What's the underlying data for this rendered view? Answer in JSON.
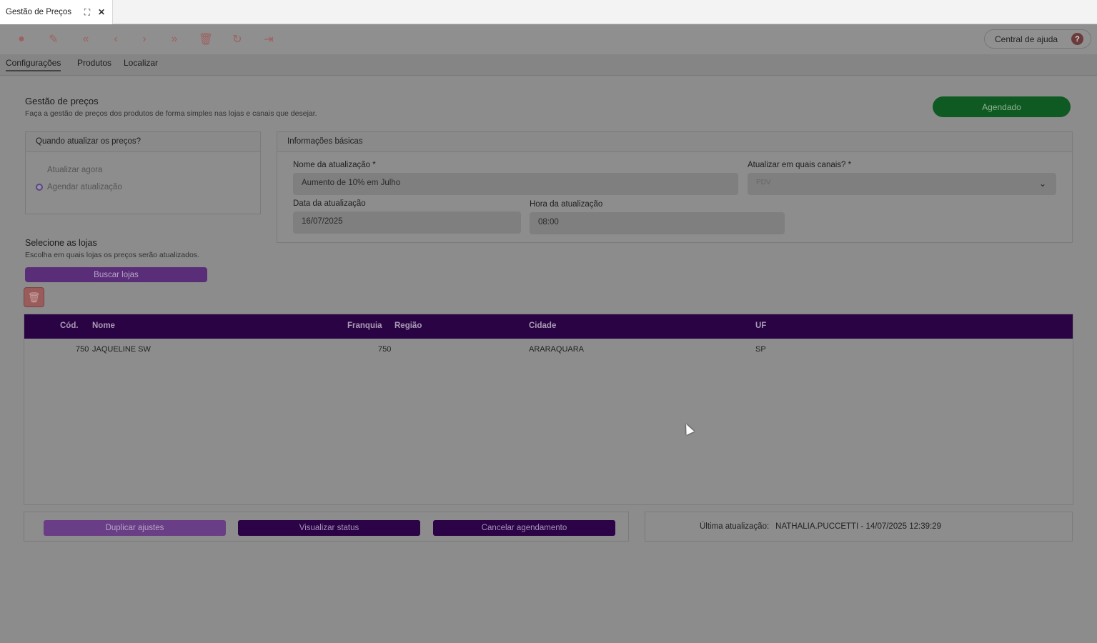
{
  "window": {
    "tab_title": "Gestão de Preços",
    "maximize_glyph": "⛶",
    "close_glyph": "✕"
  },
  "toolbar": {
    "buttons": [
      {
        "name": "add-icon",
        "glyph": "●"
      },
      {
        "name": "edit-icon",
        "glyph": "✎"
      },
      {
        "name": "first-icon",
        "glyph": "«"
      },
      {
        "name": "prev-icon",
        "glyph": "‹"
      },
      {
        "name": "next-icon",
        "glyph": "›"
      },
      {
        "name": "last-icon",
        "glyph": "»"
      },
      {
        "name": "delete-icon",
        "glyph": "🗑"
      },
      {
        "name": "refresh-icon",
        "glyph": "↻"
      },
      {
        "name": "exit-icon",
        "glyph": "⇥"
      }
    ],
    "help_label": "Central de ajuda",
    "help_glyph": "?"
  },
  "tabs": [
    "Configurações",
    "Produtos",
    "Localizar"
  ],
  "header": {
    "title": "Gestão de preços",
    "subtitle": "Faça a gestão de preços dos produtos de forma simples nas lojas e canais que desejar.",
    "status_button": "Agendado"
  },
  "when_panel": {
    "title": "Quando atualizar os preços?",
    "options": [
      "Atualizar agora",
      "Agendar atualização"
    ],
    "selected": "Agendar atualização"
  },
  "basic_info": {
    "title": "Informações básicas",
    "name_label": "Nome da atualização *",
    "name_value": "Aumento de 10% em Julho",
    "channels_label": "Atualizar em quais canais? *",
    "channels_value": "PDV",
    "date_label": "Data da atualização",
    "date_value": "16/07/2025",
    "time_label": "Hora da atualização",
    "time_value": "08:00"
  },
  "stores": {
    "title": "Selecione as lojas",
    "subtitle": "Escolha em quais lojas os preços serão atualizados.",
    "search_button": "Buscar lojas",
    "columns": [
      "Cód.",
      "Nome",
      "Franquia",
      "Região",
      "Cidade",
      "UF"
    ],
    "rows": [
      {
        "cod": "750",
        "nome": "JAQUELINE SW",
        "franquia": "750",
        "regiao": "",
        "cidade": "ARARAQUARA",
        "uf": "SP"
      }
    ]
  },
  "footer": {
    "duplicate": "Duplicar ajustes",
    "view_status": "Visualizar status",
    "cancel": "Cancelar agendamento",
    "last_update_label": "Última atualização:",
    "last_update_value": "NATHALIA.PUCCETTI - 14/07/2025 12:39:29"
  },
  "colors": {
    "accent": "#2a0345",
    "success": "#0e5a22",
    "danger": "#9a5b5b"
  }
}
